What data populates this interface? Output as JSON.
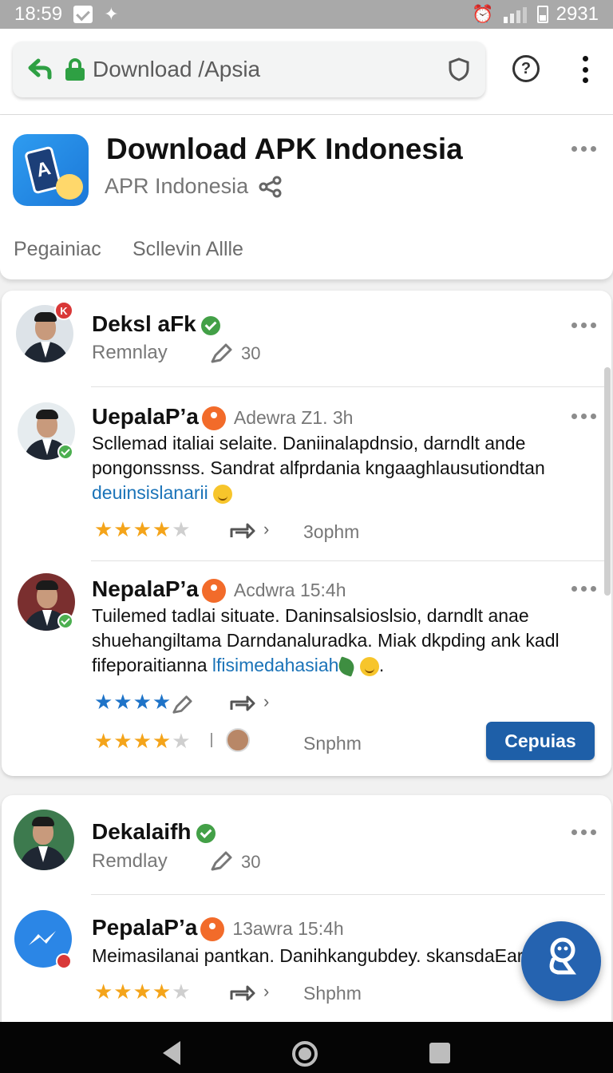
{
  "status_bar": {
    "time": "18:59",
    "battery": "2931"
  },
  "browser": {
    "url": "Download /Apsia"
  },
  "app": {
    "title": "Download APK Indonesia",
    "subtitle": "APR Indonesia",
    "tabs": [
      "Pegainiac",
      "Scllevin Allle"
    ]
  },
  "card1": {
    "header": {
      "name": "Deksl aFk",
      "sub": "Remnlay",
      "edit_count": "30",
      "badge": "K"
    },
    "posts": [
      {
        "name": "UepalaP’a",
        "time": "Adewra Z1. 3h",
        "lines": [
          "Scllemad italiai selaite. Daniinalapdnsio, darndlt ande",
          "pongonssnss. Sandrat alfprdania kngaaghlausutiondtan"
        ],
        "link": "deuinsislanarii",
        "rating": 4,
        "share_time": "3ophm"
      },
      {
        "name": "NepalaP’a",
        "time": "Acdwra 15:4h",
        "lines": [
          "Tuilemed tadlai situate. Daninsalsioslsio, darndlt anae",
          "shuehangiltama Darndanaluradka. Miak dkpding ank kadl"
        ],
        "line3_prefix": "fifeporaitianna",
        "link": "lfisimedahasiah",
        "line3_suffix": ".",
        "rating_blue": 4,
        "rating": 4,
        "share_time": "Snphm",
        "action_button": "Cepuias"
      }
    ]
  },
  "card2": {
    "header": {
      "name": "Dekalaifh",
      "sub": "Remdlay",
      "edit_count": "30"
    },
    "post": {
      "name": "PepalaP’a",
      "time": "13awra 15:4h",
      "text": "Meimasilanai pantkan. Danihkangubdey. skansdaEar",
      "rating": 4,
      "share_time": "Shphm"
    }
  },
  "icons": {
    "back": "back-arrow-icon",
    "lock": "lock-icon",
    "shield": "shield-icon",
    "help": "help-icon",
    "more": "more-vertical-icon",
    "share": "share-icon",
    "edit": "pencil-icon",
    "repost": "repost-icon",
    "location": "location-pin-icon",
    "verified": "verified-icon",
    "chat": "chat-bot-icon"
  },
  "colors": {
    "accent": "#1e5fa8",
    "star": "#f4a41a",
    "verified": "#43a047",
    "link": "#1a73b8",
    "status_bar": "#a9a9a9"
  }
}
